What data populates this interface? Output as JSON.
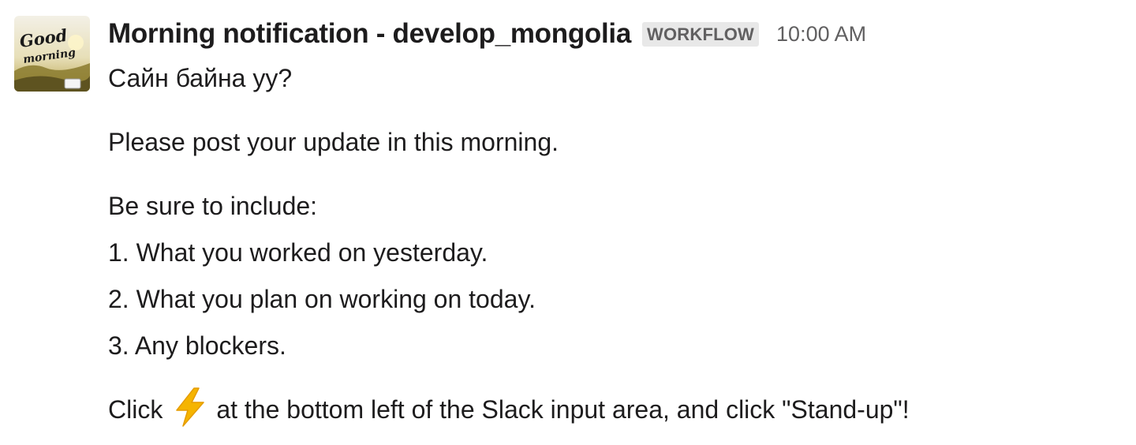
{
  "message": {
    "sender": "Morning notification - develop_mongolia",
    "badge": "WORKFLOW",
    "timestamp": "10:00 AM",
    "avatar": {
      "icon": "good-morning-avatar",
      "line1": "Good",
      "line2": "morning"
    },
    "body": {
      "greeting": "Сайн байна уу?",
      "request": "Please post your update in this morning.",
      "include_intro": "Be sure to include:",
      "items": [
        "1. What you worked on yesterday.",
        "2. What you plan on working on today.",
        "3. Any blockers."
      ],
      "instruction_before_icon": "Click",
      "instruction_icon": "lightning-bolt-icon",
      "instruction_after_icon": "at the bottom left of the Slack input area, and click \"Stand-up\"!"
    }
  },
  "colors": {
    "text": "#1d1c1d",
    "muted": "#616061",
    "badge_bg": "#e8e8e8",
    "bolt": "#f5b400"
  }
}
